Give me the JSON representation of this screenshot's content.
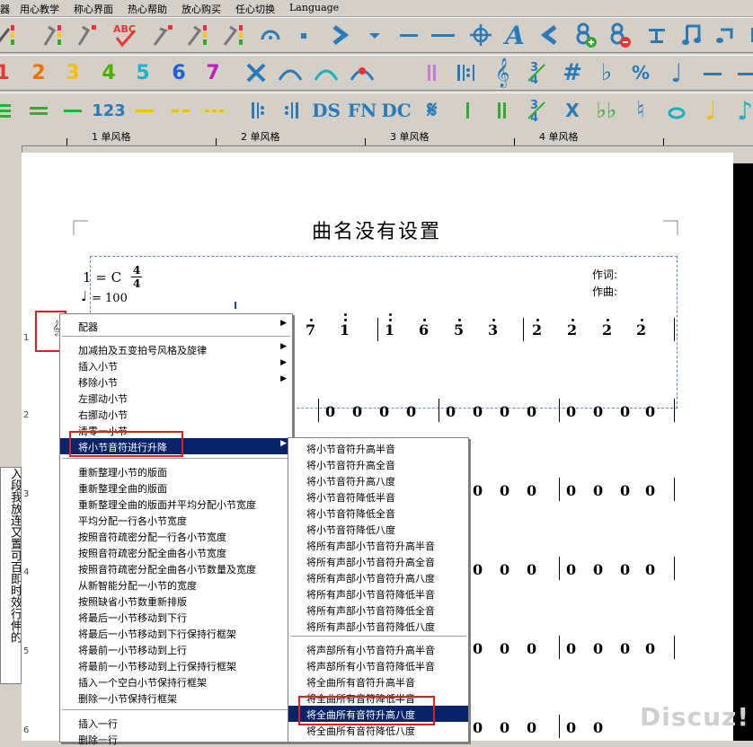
{
  "menu": {
    "items": [
      "器",
      "用心教学",
      "称心界面",
      "热心帮助",
      "放心购买",
      "任心切换",
      "Language"
    ]
  },
  "toolbar_icons": {
    "row1": [
      "blue-red-flag-icon",
      "yellow-flag-icon",
      "grey-flag-icon",
      "abc-check-icon",
      "arrow-flag-icon",
      "green-flag-icon",
      "green-red-flag-icon",
      "fermata-icon",
      "dot-icon",
      "chevron-right-icon",
      "chevron-down-icon",
      "minus-icon",
      "long-minus-icon",
      "crosshair-icon",
      "letter-a-icon",
      "chevron-left-icon",
      "eighth-add-icon",
      "eighth-remove-icon",
      "bar-line-icon",
      "music-note-icon",
      "music-flag-icon"
    ],
    "row2_numbers": [
      "1",
      "2",
      "3",
      "4",
      "5",
      "6",
      "7"
    ],
    "row2_icons": [
      "x-icon",
      "arc-icon",
      "tie-icon",
      "slur-red-icon",
      "double-bar-icon",
      "repeat-icon",
      "treble-clef-icon",
      "time-signature-icon",
      "sharp-icon",
      "flat-icon",
      "percent-icon",
      "quarter-note-icon",
      "dash-icon"
    ],
    "row3_icons": [
      "list-icon",
      "equals-icon",
      "dash-icon",
      "number-123-icon",
      "yellow-dash-icon",
      "yellow-dash-icon",
      "yellow-dash-icon",
      "repeat-start-icon",
      "repeat-end-icon",
      "ds-icon",
      "fn-icon",
      "dc-icon",
      "segno-icon",
      "bar-line-icon",
      "double-bar-icon",
      "three-four-icon",
      "x-mark-icon",
      "double-flat-icon",
      "natural-icon",
      "circle-icon",
      "note-icon"
    ],
    "row3_labels": {
      "ds": "DS",
      "fn": "FN",
      "dc": "DC",
      "n123": "123"
    }
  },
  "ruler": {
    "labels": [
      "1 单风格",
      "2 单风格",
      "3 单风格",
      "4 单风格"
    ]
  },
  "left_panel": {
    "text": "入段我放连又置可百即时效行伸的"
  },
  "score": {
    "title": "曲名没有设置",
    "key": "1 = C",
    "time_top": "4",
    "time_bottom": "4",
    "tempo": "= 100",
    "lyricist": "作词:",
    "composer": "作曲:",
    "cursor": "I",
    "row1_notes": [
      "7",
      "1",
      "1",
      "6",
      "5",
      "3",
      "2",
      "2",
      "2",
      "2"
    ],
    "zero": "0",
    "row_numbers": [
      "1",
      "2",
      "3",
      "4",
      "5",
      "6"
    ],
    "clef_glyph": "𝄞"
  },
  "context_menu": {
    "items": [
      {
        "label": "配器",
        "arrow": "▶"
      },
      {
        "label": "加减拍及五变拍号风格及旋律",
        "arrow": "▶"
      },
      {
        "label": "插入小节",
        "arrow": "▶"
      },
      {
        "label": "移除小节",
        "arrow": "▶"
      },
      {
        "label": "左挪动小节",
        "arrow": ""
      },
      {
        "label": "右挪动小节",
        "arrow": ""
      },
      {
        "label": "清零一小节",
        "arrow": ""
      },
      {
        "label": "将小节音符进行升降",
        "arrow": "▶"
      },
      {
        "label": "重新整理小节的版面",
        "arrow": ""
      },
      {
        "label": "重新整理全曲的版面",
        "arrow": ""
      },
      {
        "label": "重新整理全曲的版面并平均分配小节宽度",
        "arrow": ""
      },
      {
        "label": "平均分配一行各小节宽度",
        "arrow": ""
      },
      {
        "label": "按照音符疏密分配一行各小节宽度",
        "arrow": ""
      },
      {
        "label": "按照音符疏密分配全曲各小节宽度",
        "arrow": ""
      },
      {
        "label": "按照音符疏密分配全曲各小节数量及宽度",
        "arrow": ""
      },
      {
        "label": "从新智能分配一小节的宽度",
        "arrow": ""
      },
      {
        "label": "按照缺省小节数重新排版",
        "arrow": ""
      },
      {
        "label": "将最后一小节移动到下行",
        "arrow": ""
      },
      {
        "label": "将最后一小节移动到下行保持行框架",
        "arrow": ""
      },
      {
        "label": "将最前一小节移动到上行",
        "arrow": ""
      },
      {
        "label": "将最前一小节移动到上行保持行框架",
        "arrow": ""
      },
      {
        "label": "插入一个空白小节保持行框架",
        "arrow": ""
      },
      {
        "label": "删除一小节保持行框架",
        "arrow": ""
      },
      {
        "label": "插入一行",
        "arrow": ""
      },
      {
        "label": "删除一行",
        "arrow": ""
      }
    ]
  },
  "submenu": {
    "items": [
      "将小节音符升高半音",
      "将小节音符升高全音",
      "将小节音符升高八度",
      "将小节音符降低半音",
      "将小节音符降低全音",
      "将小节音符降低八度",
      "将所有声部小节音符升高半音",
      "将所有声部小节音符升高全音",
      "将所有声部小节音符升高八度",
      "将所有声部小节音符降低半音",
      "将所有声部小节音符降低全音",
      "将所有声部小节音符降低八度",
      "将声部所有小节音符升高半音",
      "将声部所有小节音符降低半音",
      "将全曲所有音符升高半音",
      "将全曲所有音符降低半音",
      "将全曲所有音符升高八度",
      "将全曲所有音符降低八度"
    ]
  },
  "watermark": "Discuz!",
  "colors": {
    "highlight": "#0a246a",
    "annotation": "#e02020",
    "frame": "#6b7fd8"
  }
}
